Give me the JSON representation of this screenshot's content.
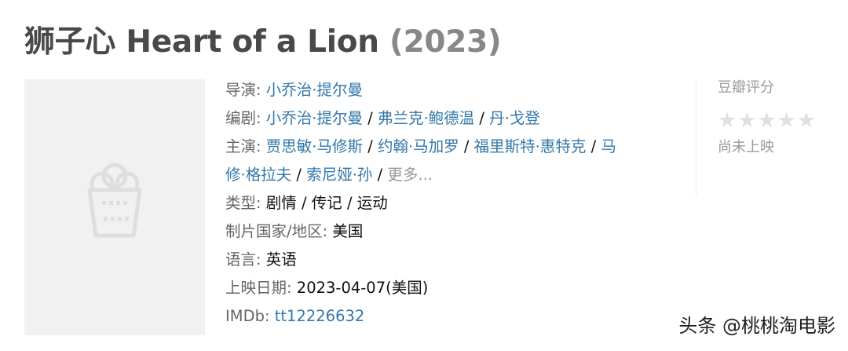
{
  "movie": {
    "title": "狮子心 Heart of a Lion",
    "year": "(2023)"
  },
  "info": {
    "director_label": "导演",
    "director": "小乔治·提尔曼",
    "writer_label": "编剧",
    "writers": [
      "小乔治·提尔曼",
      "弗兰克·鲍德温",
      "丹·戈登"
    ],
    "cast_label": "主演",
    "cast_line1": [
      "贾思敏·马修斯",
      "约翰·马加罗",
      "福里斯特·惠特克"
    ],
    "cast_split_head": "马",
    "cast_split_tail": "修·格拉夫",
    "cast_last": "索尼娅·孙",
    "more": "更多...",
    "genre_label": "类型",
    "genre": "剧情 / 传记 / 运动",
    "country_label": "制片国家/地区",
    "country": "美国",
    "language_label": "语言",
    "language": "英语",
    "release_label": "上映日期",
    "release": "2023-04-07(美国)",
    "imdb_label": "IMDb",
    "imdb": "tt12226632",
    "separator": "/",
    "colon": ":"
  },
  "rating": {
    "label": "豆瓣评分",
    "status": "尚未上映",
    "stars": 0,
    "star_glyph": "★"
  },
  "watermark": "头条 @桃桃淘电影",
  "colors": {
    "link": "#3377aa",
    "title": "#494949",
    "label": "#666666",
    "muted": "#999999"
  }
}
